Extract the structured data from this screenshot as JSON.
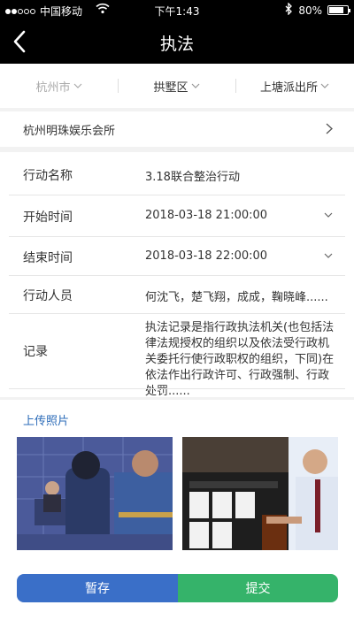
{
  "status_bar": {
    "carrier": "中国移动",
    "time": "下午1:43",
    "battery_pct": "80%",
    "battery_level": 0.8
  },
  "nav": {
    "title": "执法",
    "back_icon": "chevron-left-icon"
  },
  "filters": [
    {
      "label": "杭州市"
    },
    {
      "label": "拱墅区"
    },
    {
      "label": "上塘派出所"
    }
  ],
  "venue": {
    "name": "杭州明珠娱乐会所"
  },
  "form": {
    "action_name": {
      "label": "行动名称",
      "value": "3.18联合整治行动"
    },
    "start_time": {
      "label": "开始时间",
      "value": "2018-03-18  21:00:00"
    },
    "end_time": {
      "label": "结束时间",
      "value": "2018-03-18  22:00:00"
    },
    "personnel": {
      "label": "行动人员",
      "value": "何沈飞，楚飞翔，成成，鞠晓峰......"
    },
    "record": {
      "label": "记录",
      "value": "执法记录是指行政执法机关(也包括法律法规授权的组织以及依法受行政机关委托行使行政职权的组织，下同)在依法作出行政许可、行政强制、行政处罚......"
    }
  },
  "photos": {
    "upload_label": "上传照片"
  },
  "actions": {
    "save_label": "暂存",
    "submit_label": "提交"
  },
  "colors": {
    "accent_blue": "#3a6fc8",
    "accent_green": "#35b36a",
    "link_blue": "#2b6bb8",
    "nav_bg": "#000000"
  }
}
